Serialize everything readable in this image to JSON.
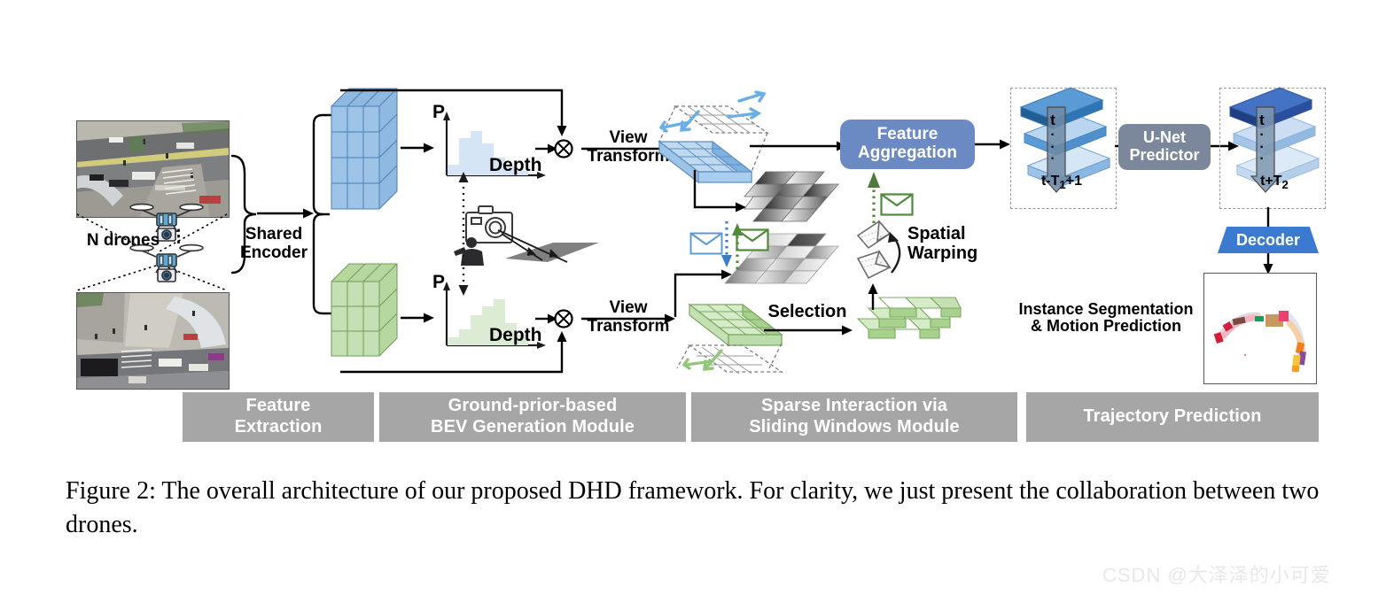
{
  "figure": {
    "caption": "Figure 2: The overall architecture of our proposed DHD framework. For clarity, we just present the collaboration between two drones.",
    "watermark": "CSDN @大泽泽的小可爱"
  },
  "colors": {
    "blue_branch": "#9dc3e6",
    "blue_branch_dark": "#5b9bd5",
    "green_branch": "#c5e0b4",
    "green_branch_dark": "#a9d18e",
    "feature_aggregation": "#6b8ac4",
    "unet_predictor": "#7b879b",
    "decoder": "#3a7ad0",
    "stage_bar": "#a6a6a6",
    "stack_top": "#2e75b6",
    "stack_mid": "#9dc3e6",
    "stack_bottom": "#deebf7",
    "envelope_blue": "#5b9bd5",
    "envelope_green": "#4f8a38",
    "ground_plane": "#808080"
  },
  "left": {
    "n_drones_label": "N drones",
    "drone_top_icon": "drone-icon",
    "drone_bottom_icon": "drone-icon",
    "aerial_image_top": "aerial-street-view-top",
    "aerial_image_bottom": "aerial-street-view-bottom",
    "shared_encoder": "Shared\nEncoder",
    "shared_encoder_line1": "Shared",
    "shared_encoder_line2": "Encoder"
  },
  "bev_module": {
    "axis_p": "P",
    "axis_depth": "Depth",
    "view_transform_line1": "View",
    "view_transform_line2": "Transform",
    "multiply_icon": "multiply-circle-icon",
    "camera_icon": "camera-icon",
    "person_icon": "person-icon",
    "ground_prior_icon": "ground-plane-icon",
    "hist_blue": [
      0.14,
      0.52,
      0.72,
      0.92,
      0.62,
      0.34,
      0.18,
      0.1
    ],
    "hist_green": [
      0.1,
      0.22,
      0.48,
      0.62,
      0.9,
      0.56,
      0.3,
      0.18
    ]
  },
  "sparse_module": {
    "selection_label": "Selection",
    "spatial_warping_line1": "Spatial",
    "spatial_warping_line2": "Warping",
    "feature_aggregation_line1": "Feature",
    "feature_aggregation_line2": "Aggregation",
    "envelope_blue_icon": "envelope-icon-blue",
    "envelope_green_icon": "envelope-icon-green",
    "frustum_icon": "frustum-pair-icon",
    "sliding_window_arrows": "sliding-window-arrows"
  },
  "trajectory_module": {
    "history_top_label": "t",
    "history_bottom_label": "t-T₁+1",
    "future_top_label": "t",
    "future_bottom_label": "t+T₂",
    "ellipsis": "·",
    "unet_line1": "U-Net",
    "unet_line2": "Predictor",
    "decoder_label": "Decoder",
    "result_caption_line1": "Instance Segmentation",
    "result_caption_line2": "& Motion Prediction",
    "result_image": "bev-instance-trajectory-result"
  },
  "stages": [
    {
      "id": "feature-extraction",
      "line1": "Feature",
      "line2": "Extraction"
    },
    {
      "id": "bev-generation",
      "line1": "Ground-prior-based",
      "line2": "BEV Generation Module"
    },
    {
      "id": "sparse-interaction",
      "line1": "Sparse Interaction via",
      "line2": "Sliding Windows Module"
    },
    {
      "id": "trajectory-prediction",
      "line1": "Trajectory Prediction",
      "line2": ""
    }
  ]
}
